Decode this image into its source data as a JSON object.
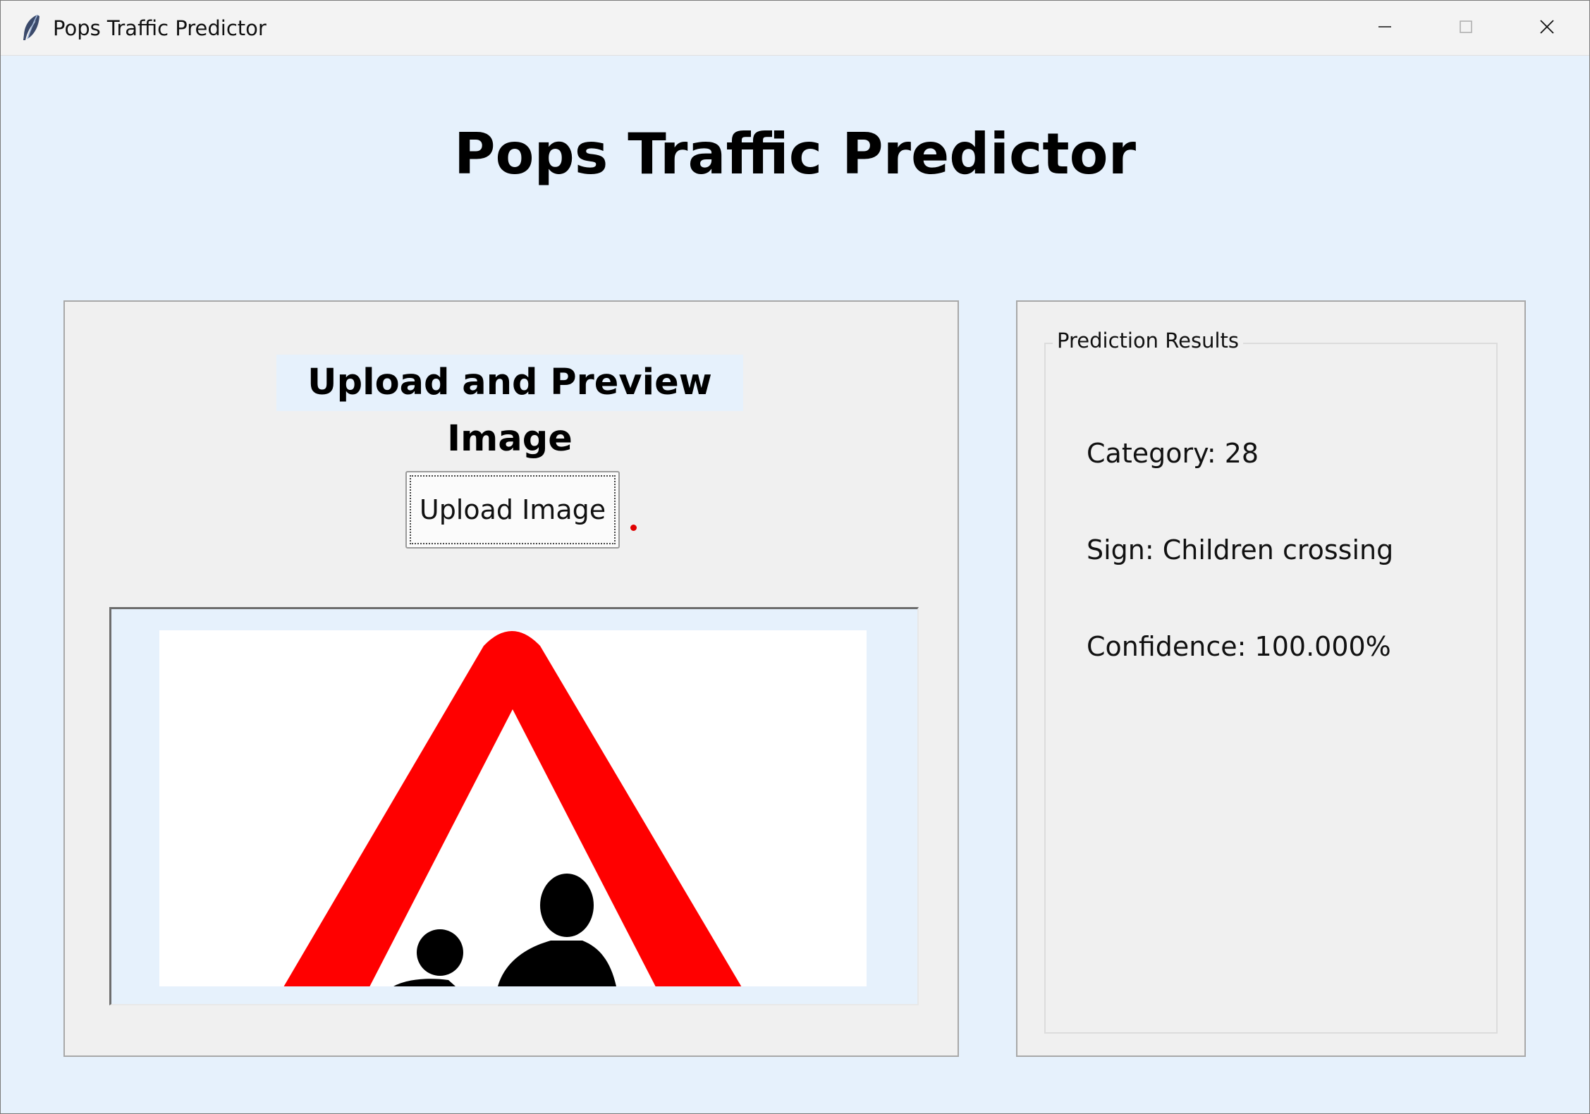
{
  "window": {
    "title": "Pops Traffic Predictor",
    "controls": [
      "minimize-icon",
      "maximize-icon",
      "close-icon"
    ]
  },
  "main": {
    "title": "Pops Traffic Predictor"
  },
  "upload_panel": {
    "heading": "Upload and Preview Image",
    "button_label": "Upload Image",
    "preview": {
      "content": "traffic-sign-children-crossing",
      "colors": {
        "border": "#ff0000",
        "figures": "#000000",
        "background": "#ffffff"
      }
    }
  },
  "results_panel": {
    "group_label": "Prediction Results",
    "category": "Category: 28",
    "sign": "Sign: Children crossing",
    "confidence": "Confidence: 100.000%"
  },
  "colors": {
    "window_bg": "#e6f1fc",
    "panel_bg": "#f0f0f0",
    "titlebar_bg": "#f3f3f3",
    "accent_dot": "#e00000"
  }
}
